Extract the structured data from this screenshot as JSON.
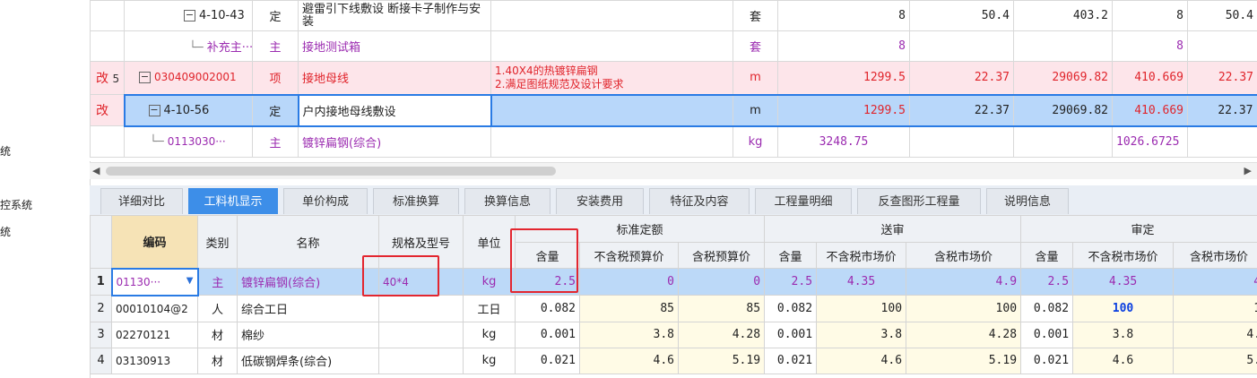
{
  "left_panel": {
    "items": [
      "统",
      "控系统",
      "统"
    ]
  },
  "upper_table": {
    "rows": [
      {
        "mark": "",
        "seq": "",
        "code": "4-10-43",
        "type": "定",
        "name": "避雷引下线敷设 断接卡子制作与安装",
        "feature": "",
        "unit": "套",
        "qty": "8",
        "price": "50.4",
        "total": "403.2",
        "qty2": "8",
        "price2": "50.4"
      },
      {
        "mark": "",
        "seq": "",
        "code": "补充主···",
        "type": "主",
        "name": "接地测试箱",
        "feature": "",
        "unit": "套",
        "qty": "8",
        "price": "",
        "total": "",
        "qty2": "8",
        "price2": ""
      },
      {
        "mark": "改",
        "seq": "5",
        "code": "030409002001",
        "type": "项",
        "name": "接地母线",
        "feature_lines": [
          "1.40X4的热镀锌扁钢",
          "2.满足图纸规范及设计要求"
        ],
        "unit": "m",
        "qty": "1299.5",
        "price": "22.37",
        "total": "29069.82",
        "qty2": "410.669",
        "price2": "22.37"
      },
      {
        "mark": "改",
        "seq": "",
        "code": "4-10-56",
        "type": "定",
        "name": "户内接地母线敷设",
        "feature": "",
        "unit": "m",
        "qty": "1299.5",
        "price": "22.37",
        "total": "29069.82",
        "qty2": "410.669",
        "price2": "22.37"
      },
      {
        "mark": "",
        "seq": "",
        "code": "0113030···",
        "type": "主",
        "name": "镀锌扁钢(综合)",
        "feature": "",
        "unit": "kg",
        "qty": "3248.75",
        "price": "",
        "total": "",
        "qty2": "1026.6725",
        "price2": ""
      }
    ]
  },
  "tabs": [
    "详细对比",
    "工料机显示",
    "单价构成",
    "标准换算",
    "换算信息",
    "安装费用",
    "特征及内容",
    "工程量明细",
    "反查图形工程量",
    "说明信息"
  ],
  "active_tab": "工料机显示",
  "lower_table": {
    "headers": {
      "code": "编码",
      "category": "类别",
      "name": "名称",
      "spec": "规格及型号",
      "unit": "单位",
      "group1": "标准定额",
      "group2": "送审",
      "group3": "审定",
      "sub1": [
        "含量",
        "不含税预算价",
        "含税预算价"
      ],
      "sub2": [
        "含量",
        "不含税市场价",
        "含税市场价"
      ],
      "sub3": [
        "含量",
        "不含税市场价",
        "含税市场价"
      ]
    },
    "rows": [
      {
        "idx": "1",
        "code": "01130···",
        "cat": "主",
        "name": "镀锌扁钢(综合)",
        "spec": "40*4",
        "unit": "kg",
        "v": [
          "2.5",
          "0",
          "0",
          "2.5",
          "4.35",
          "4.9",
          "2.5",
          "4.35",
          "4"
        ]
      },
      {
        "idx": "2",
        "code": "00010104@2",
        "cat": "人",
        "name": "综合工日",
        "spec": "",
        "unit": "工日",
        "v": [
          "0.082",
          "85",
          "85",
          "0.082",
          "100",
          "100",
          "0.082",
          "100",
          "1"
        ]
      },
      {
        "idx": "3",
        "code": "02270121",
        "cat": "材",
        "name": "棉纱",
        "spec": "",
        "unit": "kg",
        "v": [
          "0.001",
          "3.8",
          "4.28",
          "0.001",
          "3.8",
          "4.28",
          "0.001",
          "3.8",
          "4."
        ]
      },
      {
        "idx": "4",
        "code": "03130913",
        "cat": "材",
        "name": "低碳钢焊条(综合)",
        "spec": "",
        "unit": "kg",
        "v": [
          "0.021",
          "4.6",
          "5.19",
          "0.021",
          "4.6",
          "5.19",
          "0.021",
          "4.6",
          "5."
        ]
      }
    ]
  },
  "colors": {
    "accent": "#3d8ee8",
    "highlight_box": "#e3262f",
    "main_material": "#9b2bb0",
    "modified_mark": "#e0242b"
  }
}
